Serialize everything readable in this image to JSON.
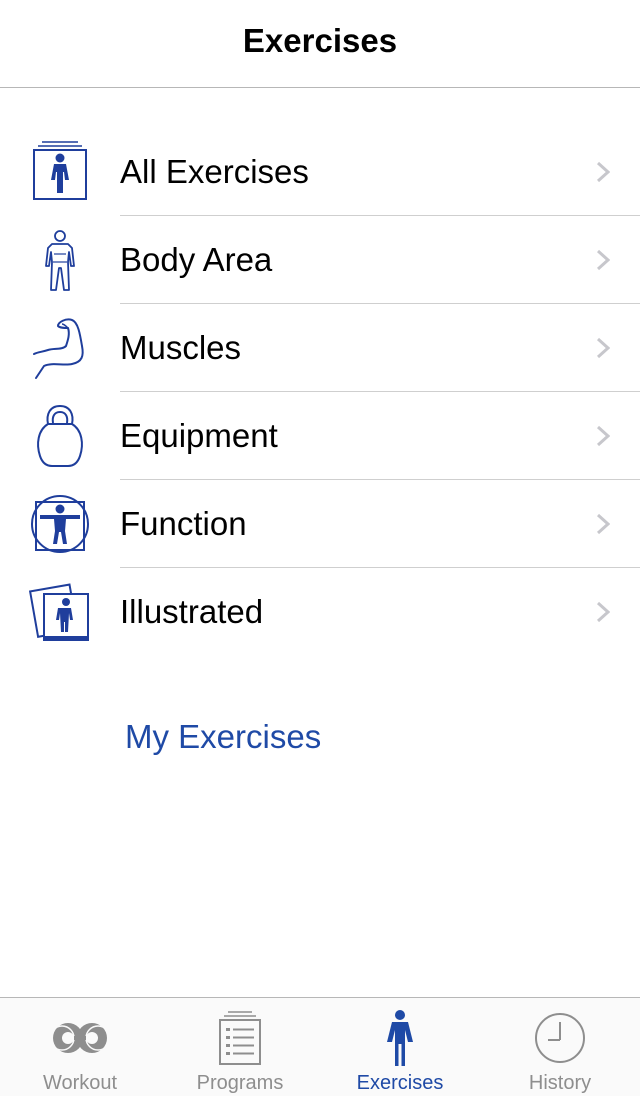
{
  "navbar": {
    "title": "Exercises"
  },
  "list": {
    "items": [
      {
        "label": "All Exercises",
        "icon": "person-in-frame-icon"
      },
      {
        "label": "Body Area",
        "icon": "body-outline-icon"
      },
      {
        "label": "Muscles",
        "icon": "flexed-arm-icon"
      },
      {
        "label": "Equipment",
        "icon": "kettlebell-icon"
      },
      {
        "label": "Function",
        "icon": "vitruvian-person-icon"
      },
      {
        "label": "Illustrated",
        "icon": "illustrated-cards-icon"
      }
    ]
  },
  "my_exercises": {
    "label": "My Exercises"
  },
  "tabbar": {
    "tabs": [
      {
        "label": "Workout",
        "icon": "dumbbell-icon",
        "active": false
      },
      {
        "label": "Programs",
        "icon": "clipboard-list-icon",
        "active": false
      },
      {
        "label": "Exercises",
        "icon": "person-icon",
        "active": true
      },
      {
        "label": "History",
        "icon": "clock-icon",
        "active": false
      }
    ]
  },
  "colors": {
    "accent": "#1f4aa6",
    "icon_blue": "#1f3e9c",
    "inactive_tab": "#8e8e8e",
    "separator": "#cfcfcf",
    "chevron": "#c7c7cc"
  }
}
